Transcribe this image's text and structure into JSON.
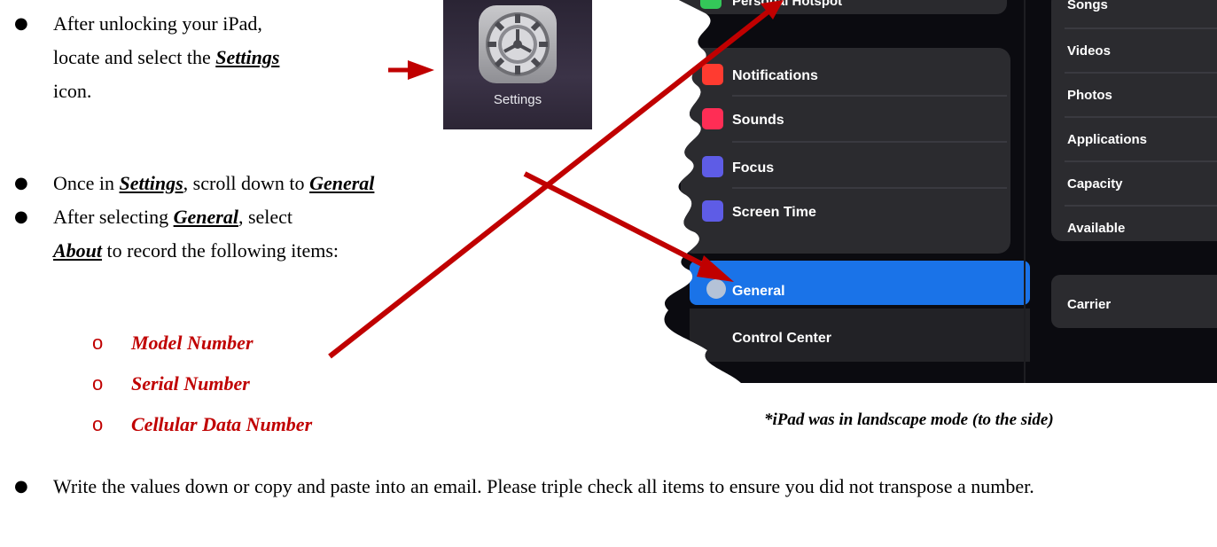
{
  "instructions": {
    "step1": {
      "text_a": "After unlocking your iPad,",
      "text_b": "locate and select the ",
      "emph": "Settings",
      "text_c": "icon."
    },
    "step2": {
      "text_a": "Once in ",
      "emph1": "Settings",
      "text_b": ", scroll down to ",
      "emph2": "General"
    },
    "step3": {
      "text_a": "After selecting ",
      "emph1": "General",
      "text_b": ", select",
      "emph2": "About",
      "text_c": " to record the following items:"
    },
    "items": [
      "Model Number",
      "Serial Number",
      "Cellular Data Number"
    ],
    "step4": "Write the values down or copy and paste into an email. Please triple check all items to ensure you did not transpose a number."
  },
  "settings_icon": {
    "label": "Settings",
    "icon": "gear-icon"
  },
  "ipad_screenshot": {
    "menu_items": [
      {
        "label": "Notifications",
        "icon": "bell-icon",
        "color": "#ff3b30"
      },
      {
        "label": "Sounds",
        "icon": "speaker-icon",
        "color": "#ff2d55"
      },
      {
        "label": "Focus",
        "icon": "moon-icon",
        "color": "#5e5ce6"
      },
      {
        "label": "Screen Time",
        "icon": "hourglass-icon",
        "color": "#5e5ce6"
      }
    ],
    "selected_item": "General",
    "next_item": "Control Center",
    "top_item_partial": "Personal Hotspot",
    "right_column": [
      "Songs",
      "Videos",
      "Photos",
      "Applications",
      "Capacity",
      "Available"
    ],
    "right_column_bottom": "Carrier",
    "accent_color": "#1a73e8"
  },
  "caption": "*iPad was in landscape mode (to the side)",
  "arrow_color": "#c00000"
}
